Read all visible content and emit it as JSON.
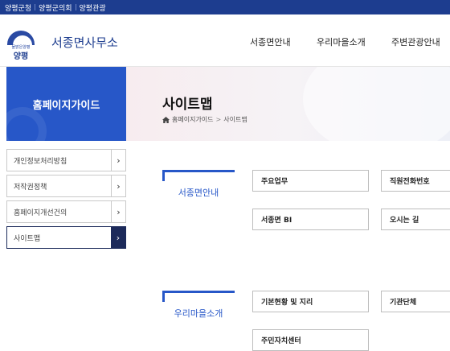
{
  "topbar": {
    "links": [
      "양평군청",
      "양평군의회",
      "양평관광"
    ]
  },
  "header": {
    "logo_text": "양평",
    "logo_small": "물맑은양평",
    "site_title": "서종면사무소",
    "nav": [
      "서종면안내",
      "우리마을소개",
      "주변관광안내"
    ]
  },
  "hero": {
    "side_title": "홈페이지가이드",
    "page_title": "사이트맵",
    "breadcrumb": [
      "홈페이지가이드",
      "사이트맵"
    ]
  },
  "sidebar": {
    "items": [
      {
        "label": "개인정보처리방침"
      },
      {
        "label": "저작권정책"
      },
      {
        "label": "홈페이지개선건의"
      },
      {
        "label": "사이트맵"
      }
    ]
  },
  "sitemap": {
    "sections": [
      {
        "title": "서종면안내",
        "links": [
          "주요업무",
          "직원전화번호",
          "서종면 BI",
          "오시는 길"
        ]
      },
      {
        "title": "우리마을소개",
        "links": [
          "기본현황 및 지리",
          "기관단체",
          "주민자치센터"
        ]
      }
    ]
  },
  "colors": {
    "topbar": "#1d3d8f",
    "accent": "#2757c8",
    "active_nav": "#1c2a5a"
  }
}
